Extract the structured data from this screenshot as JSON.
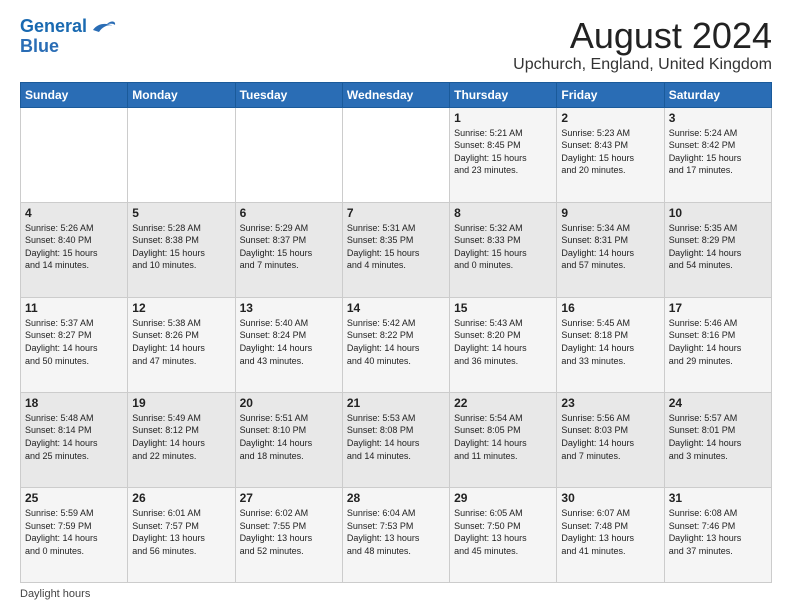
{
  "header": {
    "logo_line1": "General",
    "logo_line2": "Blue",
    "main_title": "August 2024",
    "subtitle": "Upchurch, England, United Kingdom"
  },
  "footer": {
    "daylight_note": "Daylight hours"
  },
  "days_of_week": [
    "Sunday",
    "Monday",
    "Tuesday",
    "Wednesday",
    "Thursday",
    "Friday",
    "Saturday"
  ],
  "weeks": [
    [
      {
        "day": "",
        "info": ""
      },
      {
        "day": "",
        "info": ""
      },
      {
        "day": "",
        "info": ""
      },
      {
        "day": "",
        "info": ""
      },
      {
        "day": "1",
        "info": "Sunrise: 5:21 AM\nSunset: 8:45 PM\nDaylight: 15 hours\nand 23 minutes."
      },
      {
        "day": "2",
        "info": "Sunrise: 5:23 AM\nSunset: 8:43 PM\nDaylight: 15 hours\nand 20 minutes."
      },
      {
        "day": "3",
        "info": "Sunrise: 5:24 AM\nSunset: 8:42 PM\nDaylight: 15 hours\nand 17 minutes."
      }
    ],
    [
      {
        "day": "4",
        "info": "Sunrise: 5:26 AM\nSunset: 8:40 PM\nDaylight: 15 hours\nand 14 minutes."
      },
      {
        "day": "5",
        "info": "Sunrise: 5:28 AM\nSunset: 8:38 PM\nDaylight: 15 hours\nand 10 minutes."
      },
      {
        "day": "6",
        "info": "Sunrise: 5:29 AM\nSunset: 8:37 PM\nDaylight: 15 hours\nand 7 minutes."
      },
      {
        "day": "7",
        "info": "Sunrise: 5:31 AM\nSunset: 8:35 PM\nDaylight: 15 hours\nand 4 minutes."
      },
      {
        "day": "8",
        "info": "Sunrise: 5:32 AM\nSunset: 8:33 PM\nDaylight: 15 hours\nand 0 minutes."
      },
      {
        "day": "9",
        "info": "Sunrise: 5:34 AM\nSunset: 8:31 PM\nDaylight: 14 hours\nand 57 minutes."
      },
      {
        "day": "10",
        "info": "Sunrise: 5:35 AM\nSunset: 8:29 PM\nDaylight: 14 hours\nand 54 minutes."
      }
    ],
    [
      {
        "day": "11",
        "info": "Sunrise: 5:37 AM\nSunset: 8:27 PM\nDaylight: 14 hours\nand 50 minutes."
      },
      {
        "day": "12",
        "info": "Sunrise: 5:38 AM\nSunset: 8:26 PM\nDaylight: 14 hours\nand 47 minutes."
      },
      {
        "day": "13",
        "info": "Sunrise: 5:40 AM\nSunset: 8:24 PM\nDaylight: 14 hours\nand 43 minutes."
      },
      {
        "day": "14",
        "info": "Sunrise: 5:42 AM\nSunset: 8:22 PM\nDaylight: 14 hours\nand 40 minutes."
      },
      {
        "day": "15",
        "info": "Sunrise: 5:43 AM\nSunset: 8:20 PM\nDaylight: 14 hours\nand 36 minutes."
      },
      {
        "day": "16",
        "info": "Sunrise: 5:45 AM\nSunset: 8:18 PM\nDaylight: 14 hours\nand 33 minutes."
      },
      {
        "day": "17",
        "info": "Sunrise: 5:46 AM\nSunset: 8:16 PM\nDaylight: 14 hours\nand 29 minutes."
      }
    ],
    [
      {
        "day": "18",
        "info": "Sunrise: 5:48 AM\nSunset: 8:14 PM\nDaylight: 14 hours\nand 25 minutes."
      },
      {
        "day": "19",
        "info": "Sunrise: 5:49 AM\nSunset: 8:12 PM\nDaylight: 14 hours\nand 22 minutes."
      },
      {
        "day": "20",
        "info": "Sunrise: 5:51 AM\nSunset: 8:10 PM\nDaylight: 14 hours\nand 18 minutes."
      },
      {
        "day": "21",
        "info": "Sunrise: 5:53 AM\nSunset: 8:08 PM\nDaylight: 14 hours\nand 14 minutes."
      },
      {
        "day": "22",
        "info": "Sunrise: 5:54 AM\nSunset: 8:05 PM\nDaylight: 14 hours\nand 11 minutes."
      },
      {
        "day": "23",
        "info": "Sunrise: 5:56 AM\nSunset: 8:03 PM\nDaylight: 14 hours\nand 7 minutes."
      },
      {
        "day": "24",
        "info": "Sunrise: 5:57 AM\nSunset: 8:01 PM\nDaylight: 14 hours\nand 3 minutes."
      }
    ],
    [
      {
        "day": "25",
        "info": "Sunrise: 5:59 AM\nSunset: 7:59 PM\nDaylight: 14 hours\nand 0 minutes."
      },
      {
        "day": "26",
        "info": "Sunrise: 6:01 AM\nSunset: 7:57 PM\nDaylight: 13 hours\nand 56 minutes."
      },
      {
        "day": "27",
        "info": "Sunrise: 6:02 AM\nSunset: 7:55 PM\nDaylight: 13 hours\nand 52 minutes."
      },
      {
        "day": "28",
        "info": "Sunrise: 6:04 AM\nSunset: 7:53 PM\nDaylight: 13 hours\nand 48 minutes."
      },
      {
        "day": "29",
        "info": "Sunrise: 6:05 AM\nSunset: 7:50 PM\nDaylight: 13 hours\nand 45 minutes."
      },
      {
        "day": "30",
        "info": "Sunrise: 6:07 AM\nSunset: 7:48 PM\nDaylight: 13 hours\nand 41 minutes."
      },
      {
        "day": "31",
        "info": "Sunrise: 6:08 AM\nSunset: 7:46 PM\nDaylight: 13 hours\nand 37 minutes."
      }
    ]
  ]
}
